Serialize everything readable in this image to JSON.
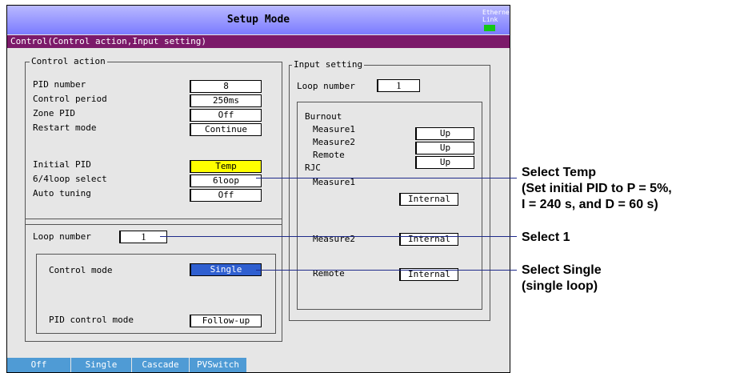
{
  "title": "Setup Mode",
  "ethernet": {
    "line1": "Ethernet",
    "line2": "Link",
    "led_color": "#14c814"
  },
  "subtitle": "Control(Control action,Input setting)",
  "control_action": {
    "heading": "Control action",
    "rows": [
      {
        "label": "PID number",
        "value": "8"
      },
      {
        "label": "Control period",
        "value": "250ms"
      },
      {
        "label": "Zone PID",
        "value": "Off"
      },
      {
        "label": "Restart mode",
        "value": "Continue"
      },
      {
        "label": "Initial PID",
        "value": "Temp"
      },
      {
        "label": "6/4loop select",
        "value": "6loop"
      },
      {
        "label": "Auto tuning",
        "value": "Off"
      }
    ],
    "loop_number_label": "Loop number",
    "loop_number_value": "1",
    "control_mode_label": "Control mode",
    "control_mode_value": "Single",
    "pid_control_mode_label": "PID control mode",
    "pid_control_mode_value": "Follow-up"
  },
  "input_setting": {
    "heading": "Input setting",
    "loop_number_label": "Loop number",
    "loop_number_value": "1",
    "burnout_label": "Burnout",
    "burnout": [
      {
        "label": "Measure1",
        "value": "Up"
      },
      {
        "label": "Measure2",
        "value": "Up"
      },
      {
        "label": "Remote",
        "value": "Up"
      }
    ],
    "rjc_label": "RJC",
    "rjc": [
      {
        "label": "Measure1",
        "value": "Internal"
      },
      {
        "label": "Measure2",
        "value": "Internal"
      },
      {
        "label": "Remote",
        "value": "Internal"
      }
    ]
  },
  "softkeys": [
    "Off",
    "Single",
    "Cascade",
    "PVSwitch"
  ],
  "callouts": {
    "temp": [
      "Select Temp",
      "(Set initial PID to P = 5%,",
      "I = 240 s, and D = 60 s)"
    ],
    "loop": [
      "Select 1"
    ],
    "single": [
      "Select Single",
      "(single loop)"
    ]
  },
  "colors": {
    "highlight_yellow": "#ffff00",
    "highlight_blue": "#2f5fd0",
    "title_bar": "#7b7bff",
    "sub_bar": "#7c1a6a",
    "softkey": "#4f9bd5",
    "leader_line": "#1e2a8a"
  }
}
